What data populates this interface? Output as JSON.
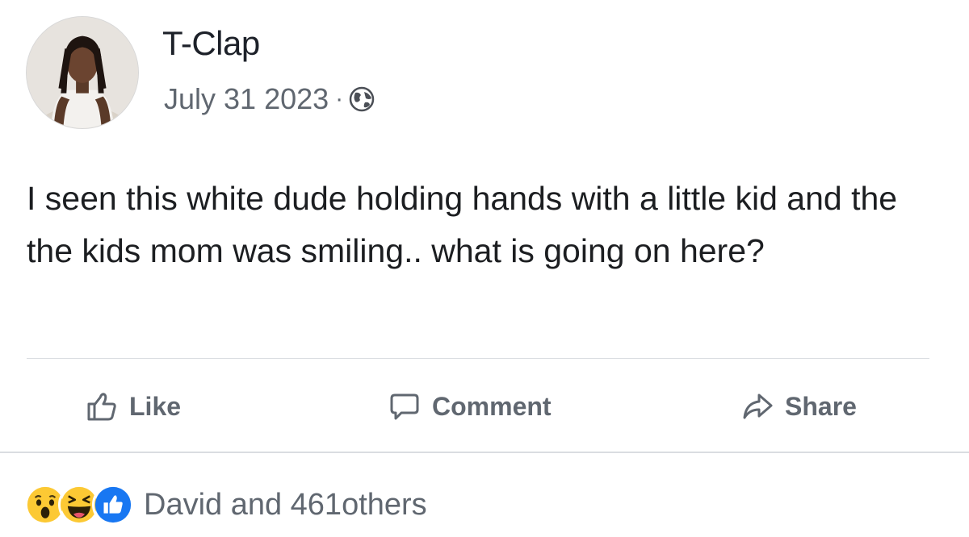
{
  "post": {
    "author": "T-Clap",
    "date": "July 31 2023",
    "separator": "·",
    "privacy_icon": "globe-icon",
    "text": "I seen this white dude holding hands with a little kid and the the kids mom was smiling.. what is going on here?"
  },
  "actions": {
    "like_label": "Like",
    "comment_label": "Comment",
    "share_label": "Share"
  },
  "reactions": {
    "icons": [
      "wow-icon",
      "haha-icon",
      "like-reaction-icon"
    ],
    "summary": "David and 461others"
  },
  "colors": {
    "action_gray": "#606770",
    "like_blue": "#1877f2",
    "reaction_yellow": "#fcc934",
    "divider": "#dadde1"
  }
}
